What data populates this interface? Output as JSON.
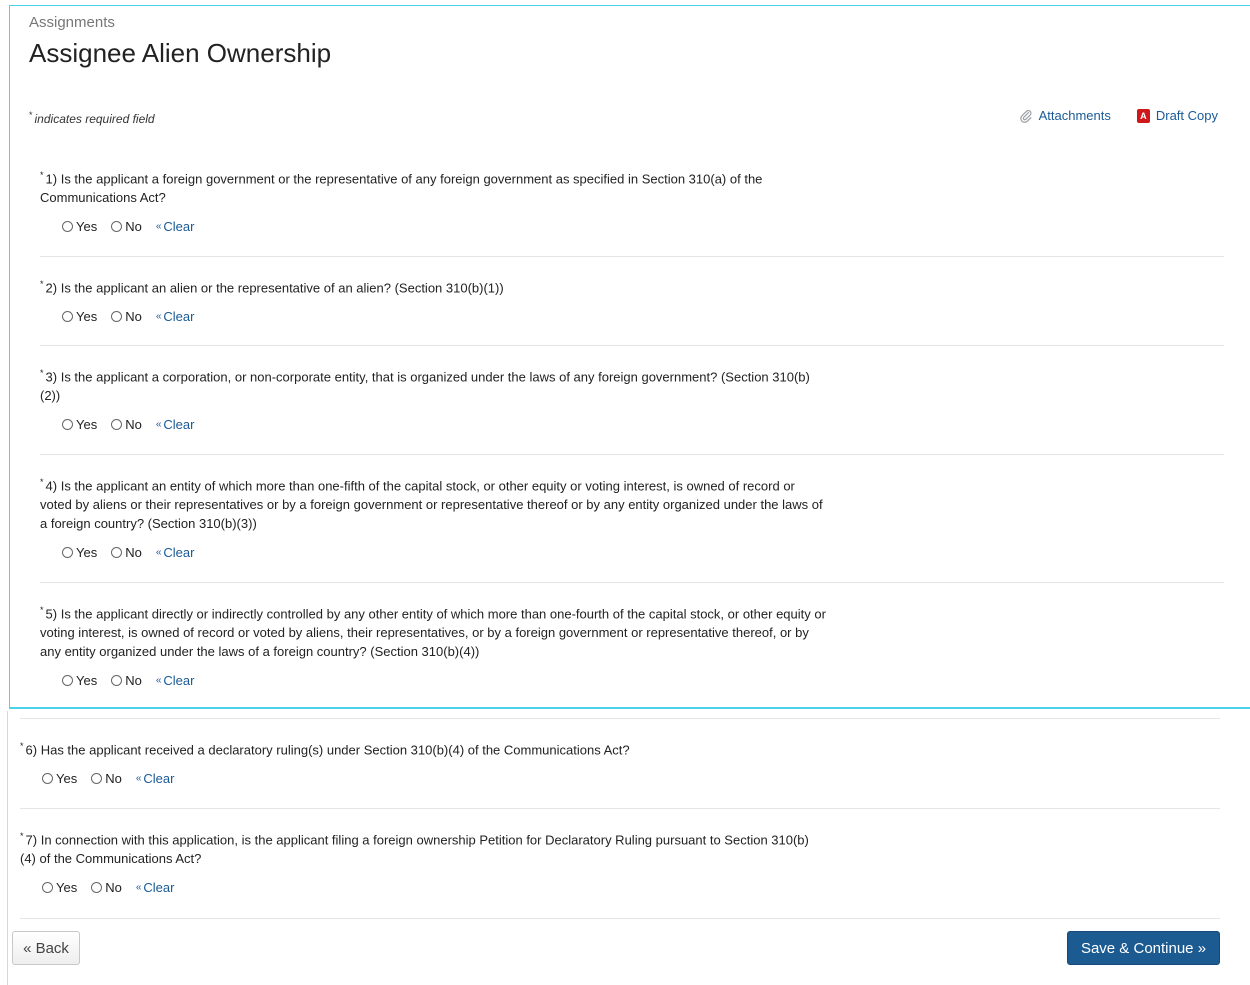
{
  "header": {
    "breadcrumb": "Assignments",
    "title": "Assignee Alien Ownership",
    "required_note": "indicates required field",
    "required_marker": "*",
    "attachments_label": "Attachments",
    "draft_copy_label": "Draft Copy"
  },
  "questions": [
    {
      "number": "1)",
      "text": "Is the applicant a foreign government or the representative of any foreign government as specified in Section 310(a) of the Communications Act?",
      "options": [
        "Yes",
        "No"
      ],
      "clear_label": "Clear"
    },
    {
      "number": "2)",
      "text": "Is the applicant an alien or the representative of an alien? (Section 310(b)(1))",
      "options": [
        "Yes",
        "No"
      ],
      "clear_label": "Clear"
    },
    {
      "number": "3)",
      "text": "Is the applicant a corporation, or non-corporate entity, that is organized under the laws of any foreign government? (Section 310(b)(2))",
      "options": [
        "Yes",
        "No"
      ],
      "clear_label": "Clear"
    },
    {
      "number": "4)",
      "text": "Is the applicant an entity of which more than one-fifth of the capital stock, or other equity or voting interest, is owned of record or voted by aliens or their representatives or by a foreign government or representative thereof or by any entity organized under the laws of a foreign country? (Section 310(b)(3))",
      "options": [
        "Yes",
        "No"
      ],
      "clear_label": "Clear"
    },
    {
      "number": "5)",
      "text": "Is the applicant directly or indirectly controlled by any other entity of which more than one-fourth of the capital stock, or other equity or voting interest, is owned of record or voted by aliens, their representatives, or by a foreign government or representative thereof, or by any entity organized under the laws of a foreign country? (Section 310(b)(4))",
      "options": [
        "Yes",
        "No"
      ],
      "clear_label": "Clear"
    },
    {
      "number": "6)",
      "text": "Has the applicant received a declaratory ruling(s) under Section 310(b)(4) of the Communications Act?",
      "options": [
        "Yes",
        "No"
      ],
      "clear_label": "Clear"
    },
    {
      "number": "7)",
      "text": "In connection with this application, is the applicant filing a foreign ownership Petition for Declaratory Ruling pursuant to Section 310(b)(4) of the Communications Act?",
      "options": [
        "Yes",
        "No"
      ],
      "clear_label": "Clear"
    }
  ],
  "footer": {
    "back_label": "« Back",
    "save_label": "Save & Continue »"
  },
  "colors": {
    "accent_border": "#49d2ea",
    "link": "#1a5a96",
    "primary_button": "#1c5a92"
  }
}
